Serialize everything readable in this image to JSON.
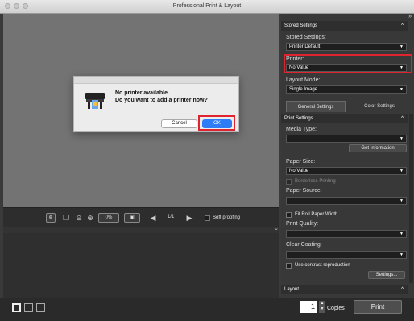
{
  "window": {
    "title": "Professional Print & Layout"
  },
  "toolbar": {
    "zoom_value": "0%",
    "page_indicator": "1/1",
    "soft_proofing_label": "Soft proofing"
  },
  "panel": {
    "stored_settings_header": "Stored Settings",
    "stored_settings_label": "Stored Settings:",
    "stored_settings_value": "Printer Default",
    "printer_label": "Printer:",
    "printer_value": "No Value",
    "layout_mode_label": "Layout Mode:",
    "layout_mode_value": "Single Image",
    "tabs": [
      {
        "label": "General Settings"
      },
      {
        "label": "Color Settings"
      }
    ],
    "print_settings_header": "Print Settings",
    "media_type_label": "Media Type:",
    "media_type_value": "",
    "get_information_label": "Get Information",
    "paper_size_label": "Paper Size:",
    "paper_size_value": "No Value",
    "borderless_label": "Borderless Printing",
    "paper_source_label": "Paper Source:",
    "paper_source_value": "",
    "fit_roll_label": "Fit Roll Paper Width",
    "print_quality_label": "Print Quality:",
    "print_quality_value": "",
    "clear_coating_label": "Clear Coating:",
    "clear_coating_value": "",
    "contrast_label": "Use contrast reproduction",
    "settings_button_label": "Settings...",
    "layout_header": "Layout"
  },
  "dialog": {
    "message_line1": "No printer available.",
    "message_line2": "Do you want to add a printer now?",
    "cancel_label": "Cancel",
    "ok_label": "OK"
  },
  "bottom": {
    "copies_value": "1",
    "copies_label": "Copies",
    "print_label": "Print"
  },
  "colors": {
    "highlight": "#e0242f",
    "ok_button": "#2f7df6",
    "tab_active": "#4a4a4a"
  }
}
